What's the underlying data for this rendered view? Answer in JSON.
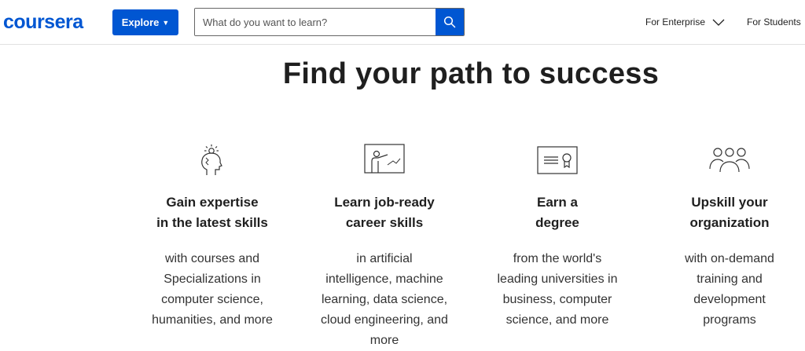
{
  "header": {
    "logo": "coursera",
    "explore_label": "Explore",
    "search_placeholder": "What do you want to learn?",
    "nav": {
      "enterprise": "For Enterprise",
      "students": "For Students"
    }
  },
  "headline": "Find your path to success",
  "features": [
    {
      "icon": "head-lightbulb-icon",
      "title": "Gain expertise\nin the latest skills",
      "description": "with courses and\nSpecializations in\ncomputer science,\nhumanities, and more"
    },
    {
      "icon": "instructor-board-icon",
      "title": "Learn job-ready\ncareer skills",
      "description": "in artificial\nintelligence, machine\nlearning, data science,\ncloud engineering, and\nmore"
    },
    {
      "icon": "certificate-icon",
      "title": "Earn a\ndegree",
      "description": "from the world's\nleading universities in\nbusiness, computer\nscience, and more"
    },
    {
      "icon": "group-people-icon",
      "title": "Upskill your\norganization",
      "description": "with on-demand\ntraining and\ndevelopment\nprograms"
    }
  ],
  "colors": {
    "brand": "#0056d2",
    "text": "#1f1f1f"
  }
}
